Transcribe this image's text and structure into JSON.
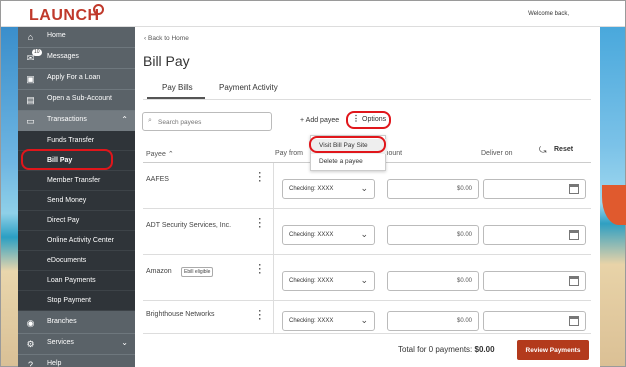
{
  "header": {
    "logo_text": "LAUNCH",
    "welcome_text": "Welcome back,"
  },
  "sidebar": {
    "items": [
      {
        "label": "Home",
        "icon": "home-icon"
      },
      {
        "label": "Messages",
        "icon": "envelope-icon",
        "badge": "10"
      },
      {
        "label": "Apply For a Loan",
        "icon": "money-icon"
      },
      {
        "label": "Open a Sub-Account",
        "icon": "document-icon"
      },
      {
        "label": "Transactions",
        "icon": "card-icon",
        "expanded": true
      }
    ],
    "sub_items": [
      {
        "label": "Funds Transfer"
      },
      {
        "label": "Bill Pay",
        "selected": true
      },
      {
        "label": "Member Transfer"
      },
      {
        "label": "Send Money"
      },
      {
        "label": "Direct Pay"
      },
      {
        "label": "Online Activity Center"
      },
      {
        "label": "eDocuments"
      },
      {
        "label": "Loan Payments"
      },
      {
        "label": "Stop Payment"
      }
    ],
    "bottom_items": [
      {
        "label": "Branches",
        "icon": "location-pin-icon"
      },
      {
        "label": "Services",
        "icon": "gear-icon"
      },
      {
        "label": "Help",
        "icon": "help-icon"
      }
    ]
  },
  "main": {
    "back_link": "Back to Home",
    "title": "Bill Pay",
    "tabs": [
      {
        "label": "Pay Bills",
        "active": true
      },
      {
        "label": "Payment Activity"
      }
    ],
    "search_placeholder": "Search payees",
    "add_payee_label": "+ Add payee",
    "options_label": "Options",
    "options_menu": [
      {
        "label": "Visit Bill Pay Site"
      },
      {
        "label": "Delete a payee"
      }
    ],
    "columns": {
      "payee": "Payee",
      "pay_from": "Pay from",
      "amount": "Amount",
      "deliver_on": "Deliver on"
    },
    "reset_label": "Reset",
    "rows": [
      {
        "payee": "AAFES",
        "account": "Checking: XXXX",
        "amount": "$0.00"
      },
      {
        "payee": "ADT Security Services, Inc.",
        "account": "Checking: XXXX",
        "amount": "$0.00"
      },
      {
        "payee": "Amazon",
        "ebill": "Ebill eligible",
        "account": "Checking: XXXX",
        "amount": "$0.00"
      },
      {
        "payee": "Brighthouse Networks",
        "account": "Checking: XXXX",
        "amount": "$0.00"
      }
    ],
    "total_label": "Total for 0 payments:",
    "total_value": "$0.00",
    "review_button": "Review Payments"
  },
  "colors": {
    "accent": "#b33a1c",
    "brand": "#c0392b",
    "sidebar": "#5a6268",
    "sidebar_sub": "#2f3439",
    "highlight": "#e0161b"
  }
}
